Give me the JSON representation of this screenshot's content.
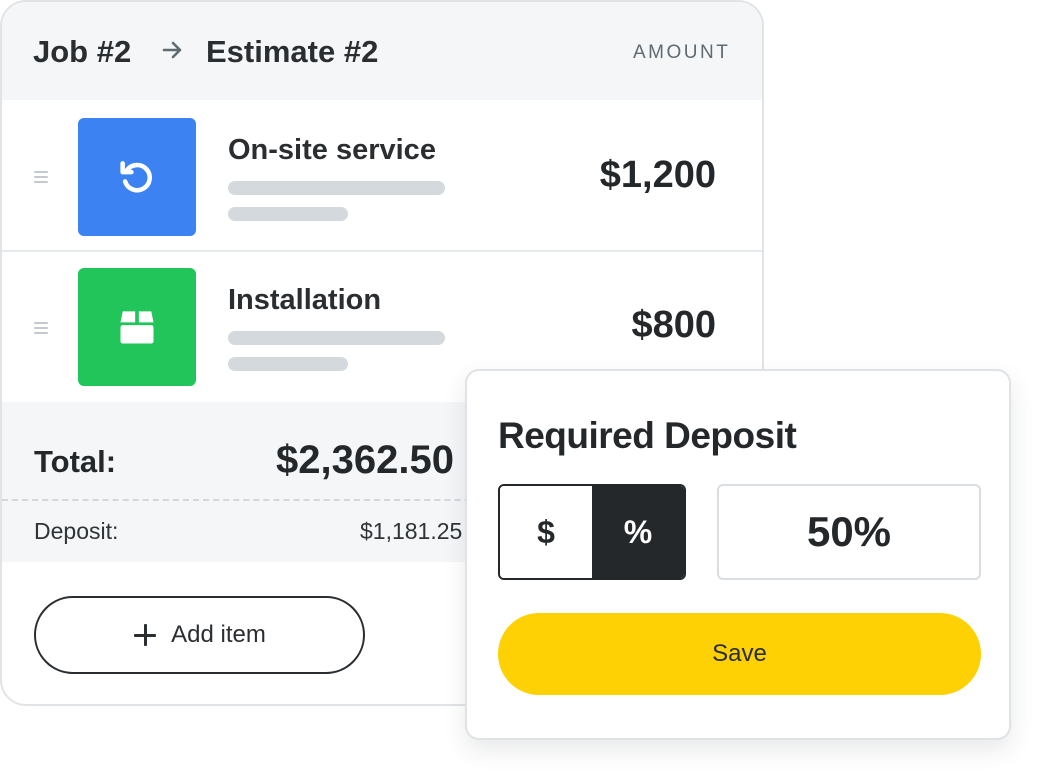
{
  "header": {
    "job": "Job #2",
    "estimate": "Estimate #2",
    "amount_column": "AMOUNT"
  },
  "items": [
    {
      "name": "On-site service",
      "amount": "$1,200",
      "icon": "rotate-ccw-icon",
      "color": "#3d82f2"
    },
    {
      "name": "Installation",
      "amount": "$800",
      "icon": "box-icon",
      "color": "#22c55a"
    }
  ],
  "totals": {
    "total_label": "Total:",
    "total_value": "$2,362.50",
    "deposit_label": "Deposit:",
    "deposit_value": "$1,181.25"
  },
  "add_item": {
    "label": "Add item"
  },
  "deposit_popover": {
    "title": "Required Deposit",
    "options": [
      "$",
      "%"
    ],
    "selected_option": "%",
    "value": "50%",
    "save_label": "Save"
  },
  "colors": {
    "accent_yellow": "#fdd104",
    "dark": "#24282b"
  }
}
